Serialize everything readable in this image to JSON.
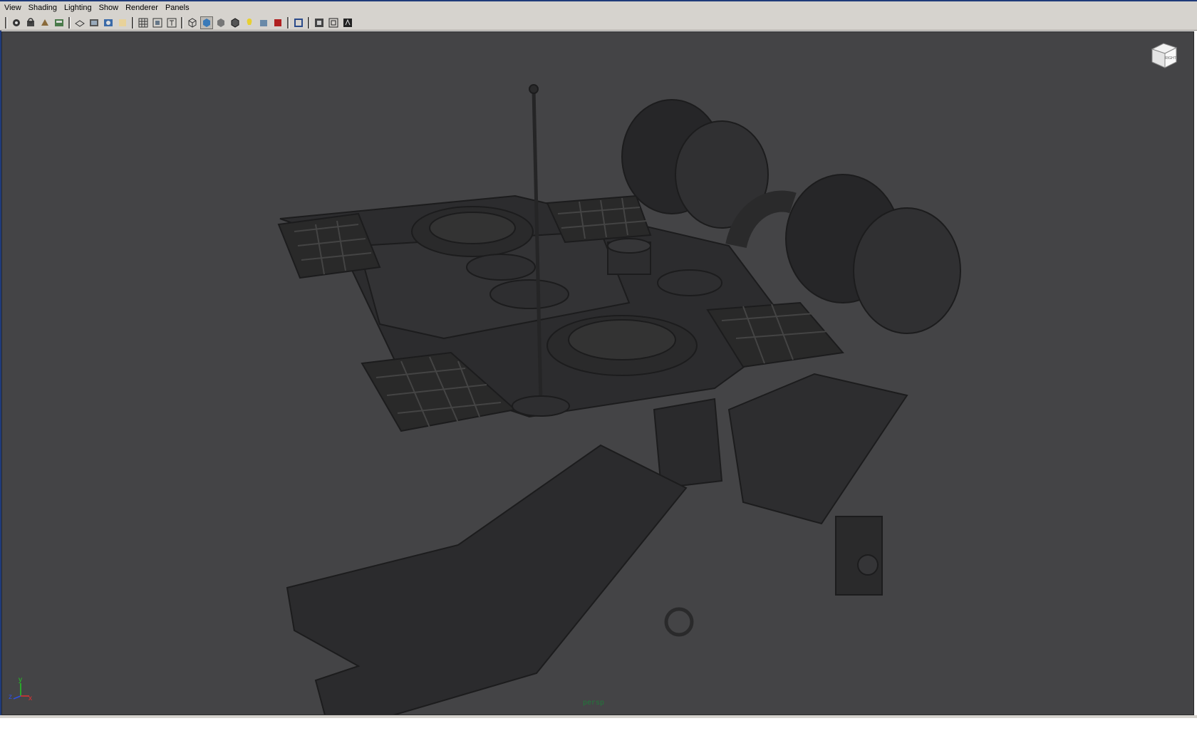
{
  "menu": [
    "View",
    "Shading",
    "Lighting",
    "Show",
    "Renderer",
    "Panels"
  ],
  "toolbar_icons": [
    "select-camera-icon",
    "lock-camera-icon",
    "camera-attributes-icon",
    "bookmark-icon",
    "image-plane-icon",
    "film-gate-icon",
    "resolution-gate-icon",
    "gate-mask-icon",
    "field-chart-icon",
    "safe-action-icon",
    "safe-title-icon",
    "wireframe-icon",
    "smooth-shade-icon",
    "default-material-icon",
    "wireframe-on-shaded-icon",
    "textured-icon",
    "lights-icon",
    "shadows-icon",
    "isolate-select-icon",
    "xray-icon",
    "xray-joints-icon",
    "xray-components-icon"
  ],
  "viewcube": {
    "face": "RIGHT"
  },
  "camera": "persp",
  "axis": {
    "x": "x",
    "y": "y",
    "z": "z"
  },
  "colors": {
    "viewport_bg": "#444446",
    "ui_bg": "#d6d3ce",
    "model": "#2e2e30",
    "camera_label": "#1f7a3a"
  }
}
